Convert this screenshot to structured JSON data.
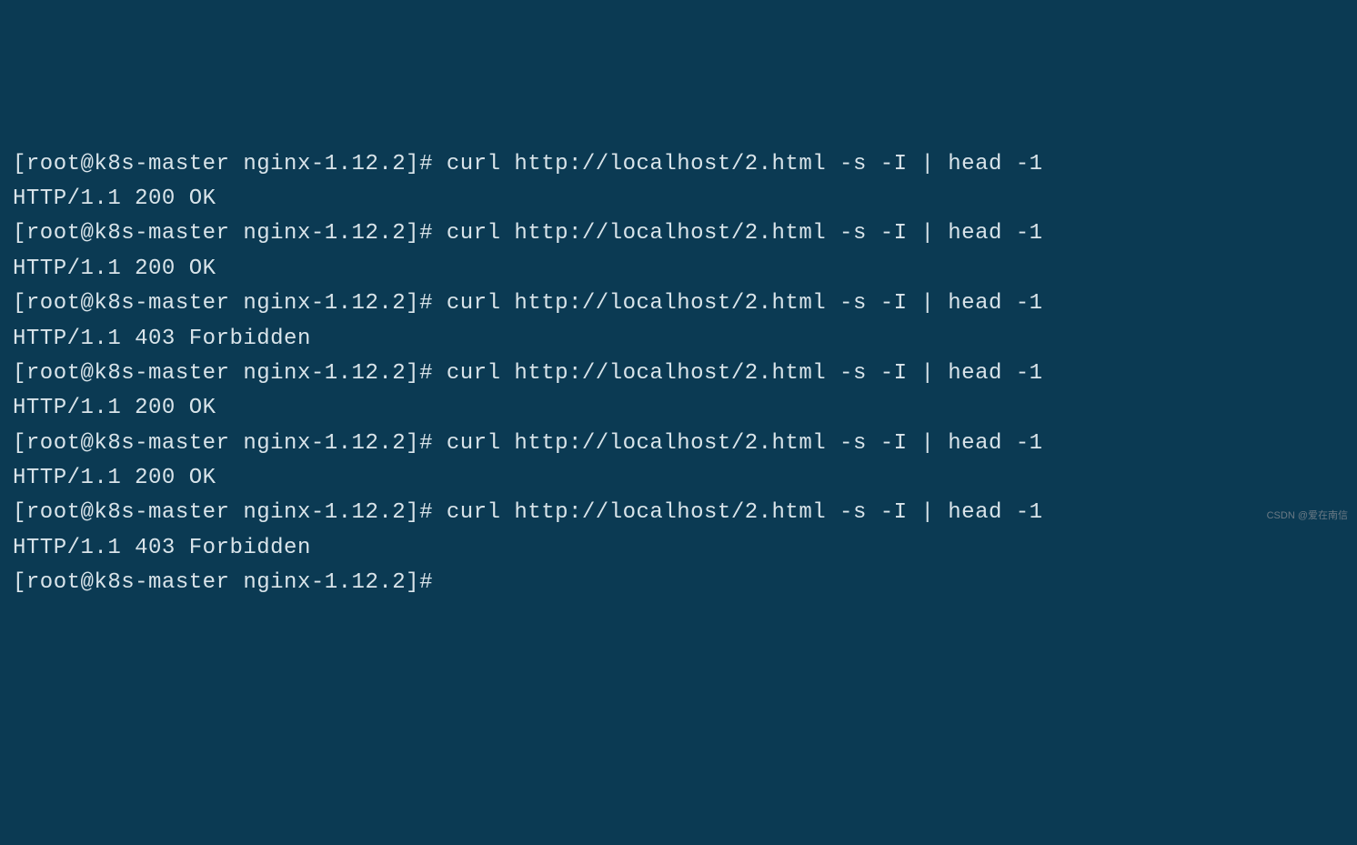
{
  "terminal": {
    "lines": [
      {
        "type": "prompt",
        "prompt": "[root@k8s-master nginx-1.12.2]# ",
        "command": "curl http://localhost/2.html -s -I | head -1"
      },
      {
        "type": "output",
        "text": "HTTP/1.1 200 OK"
      },
      {
        "type": "prompt",
        "prompt": "[root@k8s-master nginx-1.12.2]# ",
        "command": "curl http://localhost/2.html -s -I | head -1"
      },
      {
        "type": "output",
        "text": "HTTP/1.1 200 OK"
      },
      {
        "type": "prompt",
        "prompt": "[root@k8s-master nginx-1.12.2]# ",
        "command": "curl http://localhost/2.html -s -I | head -1"
      },
      {
        "type": "output",
        "text": "HTTP/1.1 403 Forbidden"
      },
      {
        "type": "prompt",
        "prompt": "[root@k8s-master nginx-1.12.2]# ",
        "command": "curl http://localhost/2.html -s -I | head -1"
      },
      {
        "type": "output",
        "text": "HTTP/1.1 200 OK"
      },
      {
        "type": "prompt",
        "prompt": "[root@k8s-master nginx-1.12.2]# ",
        "command": "curl http://localhost/2.html -s -I | head -1"
      },
      {
        "type": "output",
        "text": "HTTP/1.1 200 OK"
      },
      {
        "type": "prompt",
        "prompt": "[root@k8s-master nginx-1.12.2]# ",
        "command": "curl http://localhost/2.html -s -I | head -1"
      },
      {
        "type": "output",
        "text": "HTTP/1.1 403 Forbidden"
      },
      {
        "type": "prompt",
        "prompt": "[root@k8s-master nginx-1.12.2]# ",
        "command": ""
      }
    ]
  },
  "watermark": "CSDN @爱在南信"
}
